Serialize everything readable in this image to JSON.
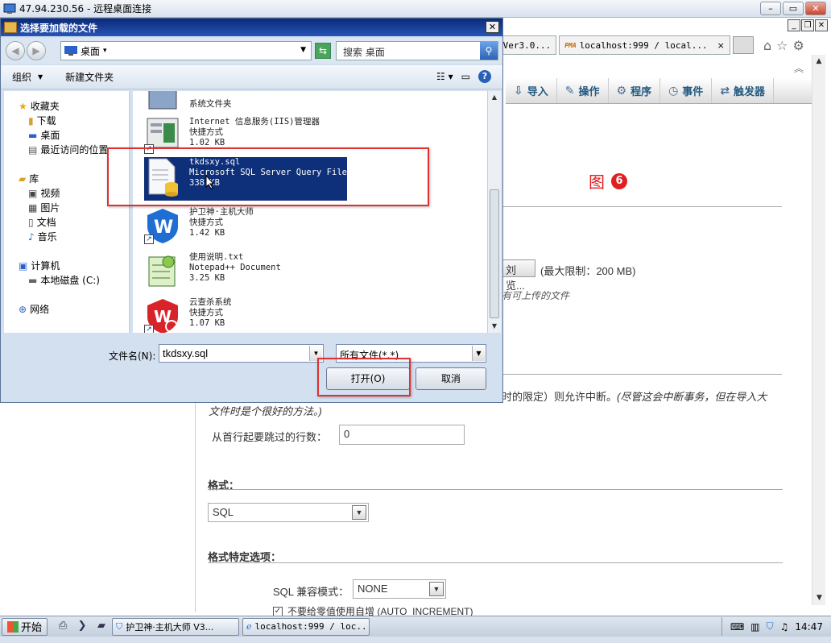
{
  "rdp": {
    "title": "47.94.230.56 - 远程桌面连接",
    "min": "–",
    "restore": "▭",
    "close": "✕"
  },
  "browser": {
    "tab1": "师 Ver3.0...",
    "tab2": "localhost:999 / local...",
    "tab2_close": "×",
    "tab2_favicon": "PMA"
  },
  "pma_nav": [
    {
      "icon": "import-icon",
      "glyph": "⇩",
      "label": "导入"
    },
    {
      "icon": "wrench-icon",
      "glyph": "✎",
      "label": "操作"
    },
    {
      "icon": "routines-icon",
      "glyph": "⚙",
      "label": "程序"
    },
    {
      "icon": "clock-icon",
      "glyph": "◷",
      "label": "事件"
    },
    {
      "icon": "trigger-icon",
      "glyph": "⇄",
      "label": "触发器"
    }
  ],
  "content": {
    "figure_label": "图",
    "figure_num": "6",
    "browse_partial": "刘览...",
    "max_limit": "(最大限制：200 MB)",
    "upload_note": "有可上传的文件",
    "interrupt_normal": "时的限定）则允许中断。",
    "interrupt_italic": "(尽管这会中断事务，但在导入大",
    "interrupt_line2": "文件时是个很好的方法。)",
    "skip_label": "从首行起要跳过的行数：",
    "skip_value": "0",
    "format_title": "格式：",
    "format_value": "SQL",
    "format_options_title": "格式特定选项：",
    "compat_label": "SQL 兼容模式：",
    "compat_value": "NONE",
    "checkbox_label": "不要给零值使用自增 (AUTO_INCREMENT)"
  },
  "dialog": {
    "title": "选择要加载的文件",
    "close": "✕",
    "location": "桌面",
    "search_placeholder": "搜索 桌面",
    "organize": "组织",
    "new_folder": "新建文件夹",
    "nav": {
      "favorites": "收藏夹",
      "downloads": "下载",
      "desktop": "桌面",
      "recent": "最近访问的位置",
      "libraries": "库",
      "videos": "视频",
      "pictures": "图片",
      "documents": "文档",
      "music": "音乐",
      "computer": "计算机",
      "local_disk": "本地磁盘 (C:)",
      "network": "网络"
    },
    "files": [
      {
        "name": "系统文件夹",
        "type": "",
        "size": ""
      },
      {
        "name": "Internet 信息服务(IIS)管理器",
        "type": "快捷方式",
        "size": "1.02 KB"
      },
      {
        "name": "tkdsxy.sql",
        "type": "Microsoft SQL Server Query File",
        "size": "338 KB"
      },
      {
        "name": "护卫神·主机大师",
        "type": "快捷方式",
        "size": "1.42 KB"
      },
      {
        "name": "使用说明.txt",
        "type": "Notepad++ Document",
        "size": "3.25 KB"
      },
      {
        "name": "云查杀系统",
        "type": "快捷方式",
        "size": "1.07 KB"
      }
    ],
    "filename_label": "文件名(N):",
    "filename_value": "tkdsxy.sql",
    "filetype_value": "所有文件(*.*)",
    "open_button": "打开(O)",
    "cancel_button": "取消"
  },
  "taskbar": {
    "start": "开始",
    "task1": "护卫神·主机大师 V3...",
    "task2": "localhost:999 / loc...",
    "clock": "14:47"
  },
  "colors": {
    "accent_red": "#e23030",
    "selection": "#0e2f79",
    "pma_link": "#235a81"
  }
}
